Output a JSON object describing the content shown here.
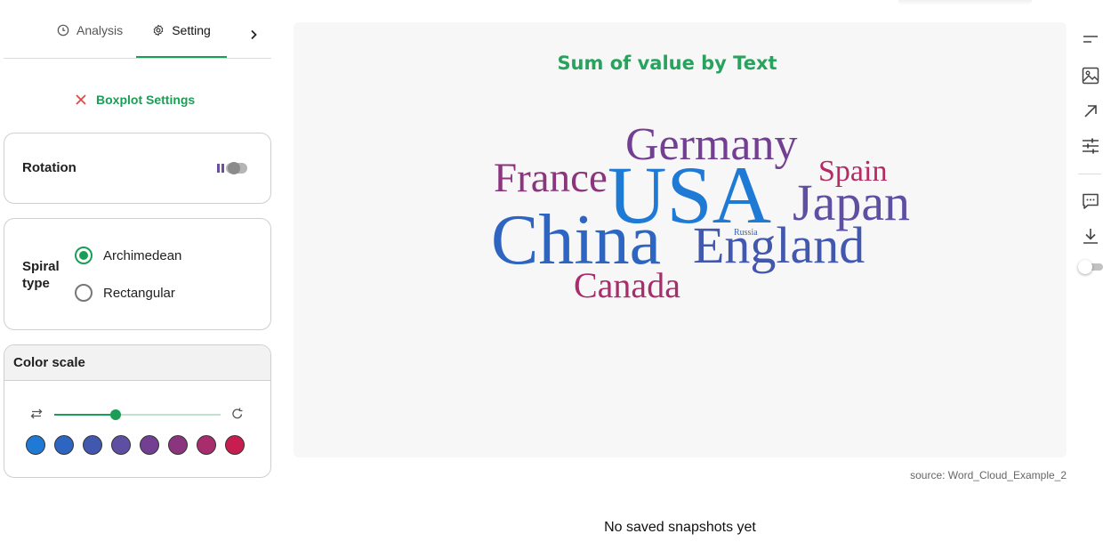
{
  "tabs": {
    "analysis_label": "Analysis",
    "setting_label": "Setting"
  },
  "settings": {
    "boxplot_label": "Boxplot Settings",
    "rotation_label": "Rotation",
    "rotation_enabled": false,
    "spiral_label": "Spiral type",
    "spiral_options": [
      "Archimedean",
      "Rectangular"
    ],
    "spiral_selected": "Archimedean",
    "color_scale_label": "Color scale",
    "color_scale_slider_value": 0.37,
    "color_swatches": [
      "#1f7ad6",
      "#2d65c0",
      "#4257ae",
      "#5f4fa2",
      "#733f93",
      "#8c357f",
      "#a82d6c",
      "#c71e4f"
    ]
  },
  "chart": {
    "title": "Sum of value by Text",
    "source": "source: Word_Cloud_Example_2"
  },
  "chart_data": {
    "type": "wordcloud",
    "title": "Sum of value by Text",
    "words": [
      {
        "text": "USA",
        "color": "#1f7ad6"
      },
      {
        "text": "China",
        "color": "#2d65c0"
      },
      {
        "text": "England",
        "color": "#4257ae"
      },
      {
        "text": "Japan",
        "color": "#5f4fa2"
      },
      {
        "text": "Germany",
        "color": "#733f93"
      },
      {
        "text": "France",
        "color": "#8c357f"
      },
      {
        "text": "Canada",
        "color": "#a82d6c"
      },
      {
        "text": "Spain",
        "color": "#b52b63"
      },
      {
        "text": "Russia",
        "color": "#2d65c0"
      }
    ]
  },
  "snapshots": {
    "empty_text": "No saved snapshots yet"
  },
  "toolbar": {
    "icons": [
      "filter-icon",
      "image-icon",
      "expand-arrow-icon",
      "sliders-icon",
      "comment-icon",
      "download-icon"
    ]
  }
}
